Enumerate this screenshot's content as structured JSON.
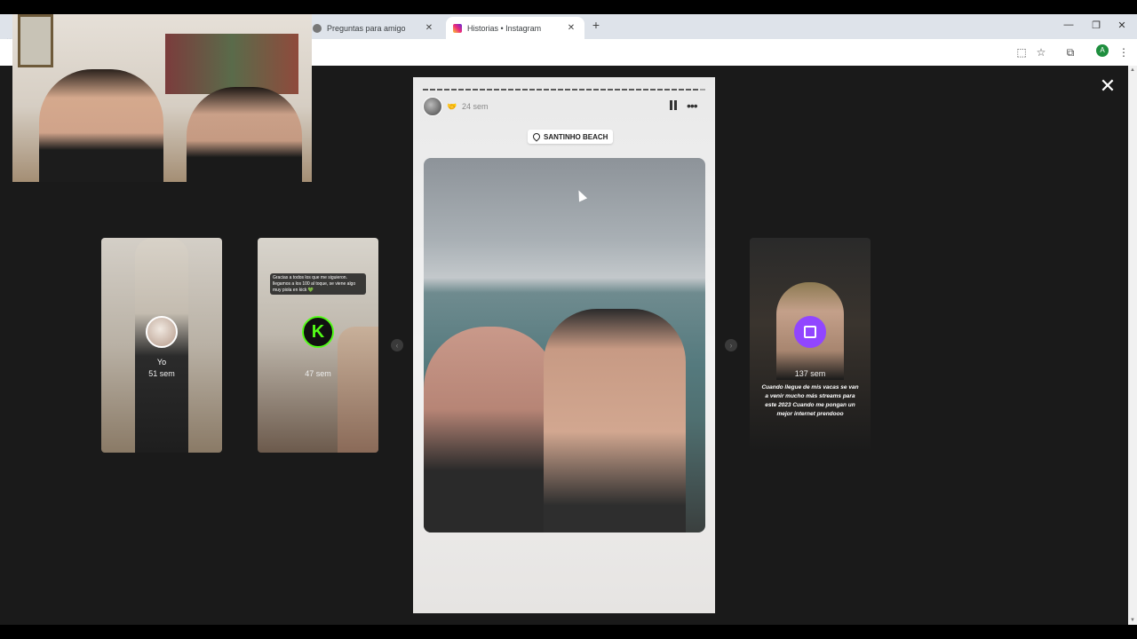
{
  "browser": {
    "tabs": [
      {
        "label": "Preguntas para amigo",
        "active": false
      },
      {
        "label": "Historias • Instagram",
        "active": true
      }
    ],
    "new_tab": "+",
    "controls": {
      "minimize": "—",
      "restore": "❐",
      "close": "✕"
    },
    "profile_initial": "A",
    "icons": [
      "install-icon",
      "star-icon",
      "extensions-icon",
      "menu-icon"
    ]
  },
  "stories": {
    "close": "✕",
    "side_left": [
      {
        "user": "Yo",
        "time": "51 sem"
      },
      {
        "user": "",
        "time": "47 sem",
        "overlay_text": "Gracias a todos los que me siguieron. llegamos a los 100 al toque, se viene algo muy piola en kick 💚"
      }
    ],
    "side_right": [
      {
        "user": "",
        "time": "137 sem",
        "overlay_text": "Cuando llegue de mis vacas se van a venir mucho más streams para este 2023 Cuando me pongan un mejor internet prendooo"
      }
    ],
    "nav": {
      "prev": "‹",
      "next": "›"
    },
    "active": {
      "emoji": "🤝",
      "time": "24 sem",
      "location": "SANTINHO BEACH",
      "more": "•••",
      "segments": 40
    }
  },
  "colors": {
    "viewer_bg": "#1a1a1a",
    "kick_green": "#53fc18",
    "twitch_purple": "#9146ff"
  }
}
